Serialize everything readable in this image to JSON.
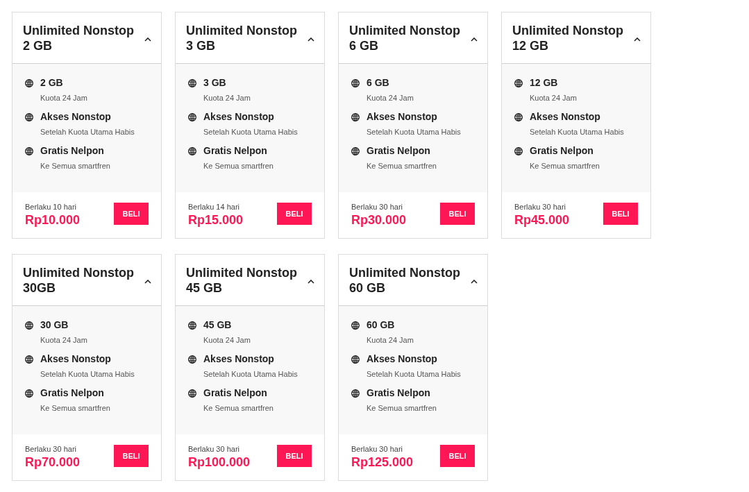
{
  "plans": [
    {
      "title": "Unlimited Nonstop 2 GB",
      "expanded": true,
      "features": [
        {
          "title": "2 GB",
          "subtitle": "Kuota 24 Jam"
        },
        {
          "title": "Akses Nonstop",
          "subtitle": "Setelah Kuota Utama Habis"
        },
        {
          "title": "Gratis Nelpon",
          "subtitle": "Ke Semua smartfren"
        }
      ],
      "validity": "Berlaku 10 hari",
      "price": "Rp10.000",
      "button": "BELI"
    },
    {
      "title": "Unlimited Nonstop 3 GB",
      "expanded": true,
      "features": [
        {
          "title": "3 GB",
          "subtitle": "Kuota 24 Jam"
        },
        {
          "title": "Akses Nonstop",
          "subtitle": "Setelah Kuota Utama Habis"
        },
        {
          "title": "Gratis Nelpon",
          "subtitle": "Ke Semua smartfren"
        }
      ],
      "validity": "Berlaku 14 hari",
      "price": "Rp15.000",
      "button": "BELI"
    },
    {
      "title": "Unlimited Nonstop 6 GB",
      "expanded": true,
      "features": [
        {
          "title": "6 GB",
          "subtitle": "Kuota 24 Jam"
        },
        {
          "title": "Akses Nonstop",
          "subtitle": "Setelah Kuota Utama Habis"
        },
        {
          "title": "Gratis Nelpon",
          "subtitle": "Ke Semua smartfren"
        }
      ],
      "validity": "Berlaku 30 hari",
      "price": "Rp30.000",
      "button": "BELI"
    },
    {
      "title": "Unlimited Nonstop 12 GB",
      "expanded": true,
      "features": [
        {
          "title": "12 GB",
          "subtitle": "Kuota 24 Jam"
        },
        {
          "title": "Akses Nonstop",
          "subtitle": "Setelah Kuota Utama Habis"
        },
        {
          "title": "Gratis Nelpon",
          "subtitle": "Ke Semua smartfren"
        }
      ],
      "validity": "Berlaku 30 hari",
      "price": "Rp45.000",
      "button": "BELI"
    },
    {
      "title": "Unlimited Nonstop 30GB",
      "expanded": true,
      "features": [
        {
          "title": "30 GB",
          "subtitle": "Kuota 24 Jam"
        },
        {
          "title": "Akses Nonstop",
          "subtitle": "Setelah Kuota Utama Habis"
        },
        {
          "title": "Gratis Nelpon",
          "subtitle": "Ke Semua smartfren"
        }
      ],
      "validity": "Berlaku 30 hari",
      "price": "Rp70.000",
      "button": "BELI"
    },
    {
      "title": "Unlimited Nonstop 45 GB",
      "expanded": true,
      "features": [
        {
          "title": "45 GB",
          "subtitle": "Kuota 24 Jam"
        },
        {
          "title": "Akses Nonstop",
          "subtitle": "Setelah Kuota Utama Habis"
        },
        {
          "title": "Gratis Nelpon",
          "subtitle": "Ke Semua smartfren"
        }
      ],
      "validity": "Berlaku 30 hari",
      "price": "Rp100.000",
      "button": "BELI"
    },
    {
      "title": "Unlimited Nonstop 60 GB",
      "expanded": true,
      "features": [
        {
          "title": "60 GB",
          "subtitle": "Kuota 24 Jam"
        },
        {
          "title": "Akses Nonstop",
          "subtitle": "Setelah Kuota Utama Habis"
        },
        {
          "title": "Gratis Nelpon",
          "subtitle": "Ke Semua smartfren"
        }
      ],
      "validity": "Berlaku 30 hari",
      "price": "Rp125.000",
      "button": "BELI"
    }
  ]
}
